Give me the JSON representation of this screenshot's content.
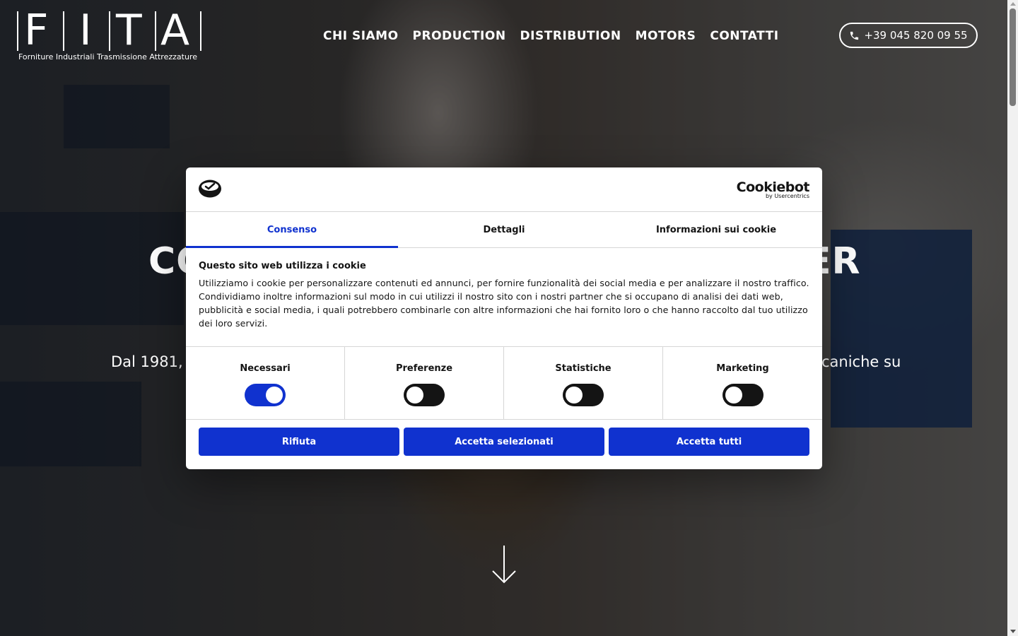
{
  "brand": {
    "letters": [
      "F",
      "I",
      "T",
      "A"
    ],
    "tagline": "Forniture  Industriali  Trasmissione  Attrezzature"
  },
  "nav": {
    "items": [
      "CHI SIAMO",
      "PRODUCTION",
      "DISTRIBUTION",
      "MOTORS",
      "CONTATTI"
    ],
    "phone": "+39 045 820 09 55"
  },
  "hero": {
    "headline_left": "CO",
    "headline_right": "ER",
    "subtitle_left": "Dal 1981,",
    "subtitle_right": "caniche su"
  },
  "cookie_dialog": {
    "provider_name": "Cookiebot",
    "provider_by": "by Usercentrics",
    "tabs": [
      "Consenso",
      "Dettagli",
      "Informazioni sui cookie"
    ],
    "active_tab": "Consenso",
    "title": "Questo sito web utilizza i cookie",
    "body": "Utilizziamo i cookie per personalizzare contenuti ed annunci, per fornire funzionalità dei social media e per analizzare il nostro traffico. Condividiamo inoltre informazioni sul modo in cui utilizzi il nostro sito con i nostri partner che si occupano di analisi dei dati web, pubblicità e social media, i quali potrebbero combinarle con altre informazioni che hai fornito loro o che hanno raccolto dal tuo utilizzo dei loro servizi.",
    "toggles": [
      {
        "label": "Necessari",
        "on": true
      },
      {
        "label": "Preferenze",
        "on": false
      },
      {
        "label": "Statistiche",
        "on": false
      },
      {
        "label": "Marketing",
        "on": false
      }
    ],
    "buttons": {
      "reject": "Rifiuta",
      "accept_selected": "Accetta selezionati",
      "accept_all": "Accetta tutti"
    }
  },
  "colors": {
    "accent": "#1032cf",
    "toggle_off": "#141414"
  }
}
